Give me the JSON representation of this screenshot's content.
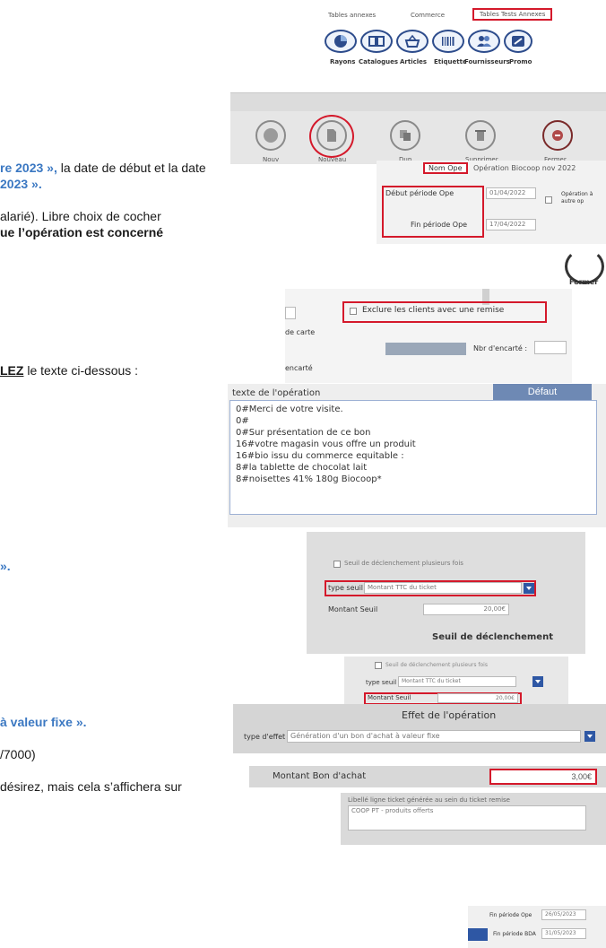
{
  "toolbar1": {
    "tabs": [
      "Tables annexes",
      "Commerce",
      "Tables Tests Annexes"
    ],
    "items": [
      {
        "label": "Rayons",
        "icon": "pie-chart-icon"
      },
      {
        "label": "Catalogues",
        "icon": "book-icon"
      },
      {
        "label": "Articles",
        "icon": "basket-icon"
      },
      {
        "label": "Etiquette",
        "icon": "barcode-icon"
      },
      {
        "label": "Fournisseurs",
        "icon": "people-icon"
      },
      {
        "label": "Promo",
        "icon": "promo-icon"
      }
    ]
  },
  "toolbar2": {
    "items": [
      {
        "label": "Nouv",
        "icon": "new-icon"
      },
      {
        "label": "Nouveau",
        "icon": "document-icon"
      },
      {
        "label": "Dup",
        "icon": "duplicate-icon"
      },
      {
        "label": "Supprimer",
        "icon": "trash-icon"
      },
      {
        "label": "Fermer",
        "icon": "close-icon"
      }
    ]
  },
  "doc": {
    "line1a": "re 2023 »,",
    "line1b": " la date de début et la date",
    "line2": "2023 ».",
    "line3": "alarié). Libre choix de cocher",
    "line4": "ue l’opération est concerné",
    "line5a": "LEZ",
    "line5b": " le texte ci-dessous :",
    "line6": "».",
    "line7": "à valeur fixe ».",
    "line8": "/7000)",
    "line9": "désirez, mais cela s’affichera sur"
  },
  "period_panel": {
    "nom_label": "Nom Ope",
    "nom_value": "Opération Biocoop nov 2022",
    "debut_label": "Début période Ope",
    "debut_value": "01/04/2022",
    "fin_label": "Fin période Ope",
    "fin_value": "17/04/2022",
    "side_text": "Opération à autre op",
    "fermer": "Fermer"
  },
  "exclude_panel": {
    "exclude_label": "Exclure les clients avec une remise",
    "carte_label": "de carte",
    "nbr_label": "Nbr d'encarté :",
    "encarte_label": "encarté"
  },
  "texte_panel": {
    "title": "texte de l'opération",
    "defaut_button": "Défaut",
    "lines": [
      "0#Merci de votre visite.",
      "0#",
      "0#Sur présentation de ce bon",
      "16#votre magasin vous offre un produit",
      "16#bio issu du commerce equitable :",
      "8#la tablette de chocolat lait",
      "8#noisettes 41% 180g Biocoop*"
    ]
  },
  "seuil_panel": {
    "checkbox_label": "Seuil de déclenchement plusieurs fois",
    "type_label": "type seuil",
    "type_value": "Montant TTC du ticket",
    "montant_label": "Montant Seuil",
    "montant_value": "20,00€",
    "footer": "Seuil de déclenchement"
  },
  "seuil_panel2": {
    "checkbox_label": "Seuil de déclenchement plusieurs fois",
    "type_label": "type seuil",
    "type_value": "Montant TTC du ticket",
    "montant_label": "Montant Seuil",
    "montant_value": "20,00€"
  },
  "effet_panel": {
    "title": "Effet de l'opération",
    "type_label": "type d'effet",
    "type_value": "Génération d'un bon d'achat à valeur fixe"
  },
  "bon_panel": {
    "label": "Montant Bon d'achat",
    "value": "3,00€"
  },
  "libelle_panel": {
    "line1": "Libellé ligne ticket générée au sein du ticket remise",
    "line2": "COOP PT - produits offerts"
  },
  "dates_panel": {
    "fin_ope_label": "Fin période Ope",
    "fin_ope_value": "26/05/2023",
    "fin_bda_label": "Fin période BDA",
    "fin_bda_value": "31/05/2023"
  }
}
